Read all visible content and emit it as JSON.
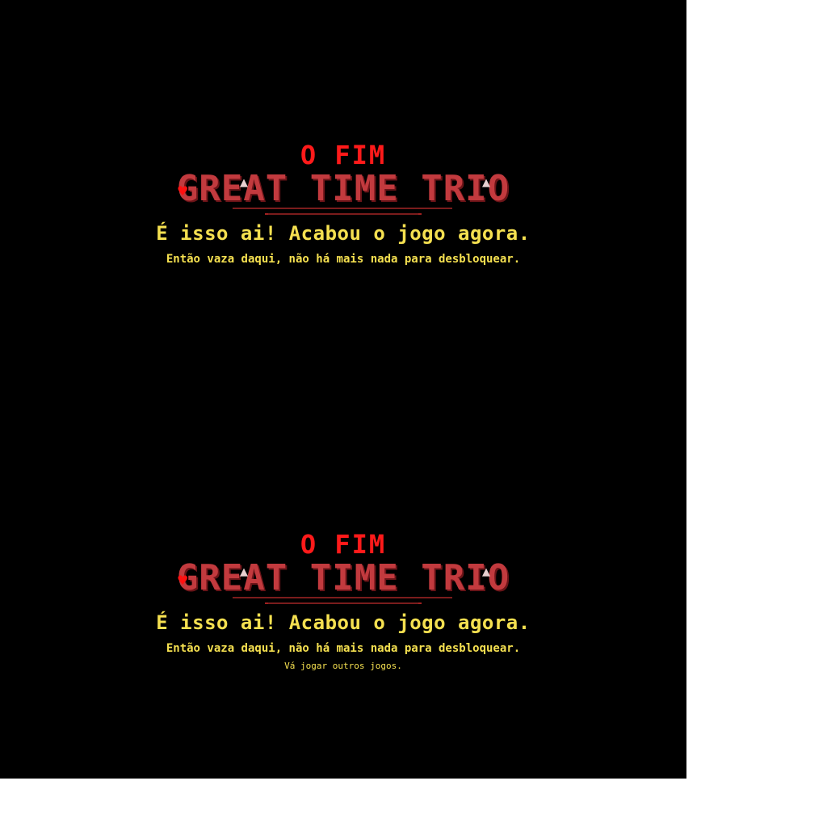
{
  "colors": {
    "background": "#000000",
    "title_red": "#ff1a1a",
    "logo_red": "#c23a3e",
    "text_yellow": "#f5e050"
  },
  "icons": {
    "logo_heart": "heart-icon",
    "logo_arrow": "arrow-up-icon"
  },
  "panels": [
    {
      "the_end": "O FIM",
      "logo": "GREAT TIME TRIO",
      "heart_glyph": "♥",
      "arrow_glyph": "▲",
      "main_line": "É isso ai! Acabou o jogo agora.",
      "sub_line": "Então vaza daqui, não há mais nada para desbloquear.",
      "extra_line": ""
    },
    {
      "the_end": "O FIM",
      "logo": "GREAT TIME TRIO",
      "heart_glyph": "♥",
      "arrow_glyph": "▲",
      "main_line": "É isso ai! Acabou o jogo agora.",
      "sub_line": "Então vaza daqui, não há mais nada para desbloquear.",
      "extra_line": "Vá jogar outros jogos."
    }
  ]
}
